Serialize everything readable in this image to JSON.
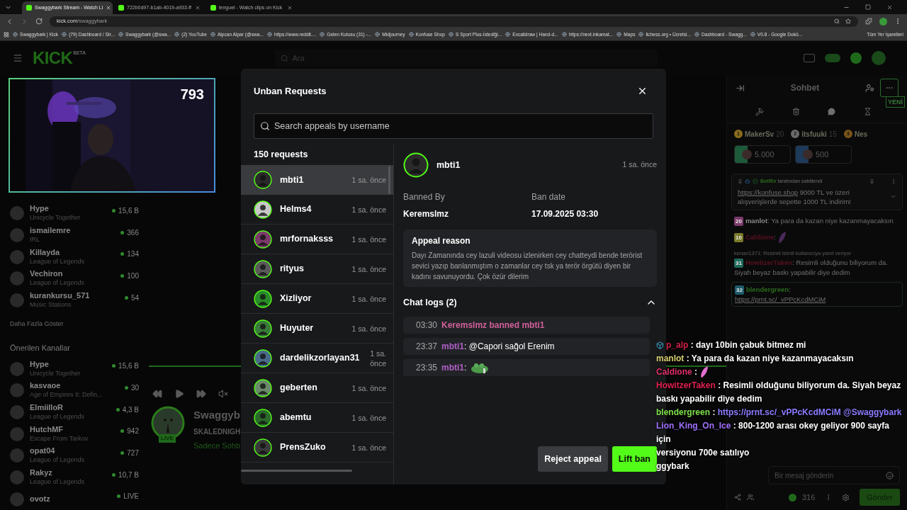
{
  "browser": {
    "tabs": [
      {
        "title": "Swaggybark Stream - Watch Li",
        "selected": true
      },
      {
        "title": "722b0d97-b1ab-4019-a933-ff",
        "selected": false
      },
      {
        "title": "lenguel - Watch clips on Kick",
        "selected": false
      }
    ],
    "url_host": "kick.com",
    "url_path": "/swaggybark",
    "bookmarks": [
      "Swaggybark | Kick",
      "(79) Dashboard / Str...",
      "Swaggybark (@swa...",
      "(2) YouTube",
      "Alpcan Alpar (@swa...",
      "https://www.reddit....",
      "Gelen Kutusu (31) -...",
      "Midjourney",
      "Konfuse Shop",
      "S Sport Plus-İstediği...",
      "Excalidraw | Hand-d...",
      "https://next.inkamat...",
      "Maps",
      "lichess.org • Ücretsi...",
      "Dashboard - Swagg...",
      "V0.8 - Google Dokü..."
    ],
    "all_bookmarks": "Tüm Yer İşaretleri"
  },
  "nav": {
    "logo": "KICK",
    "logo_tag": "BETA",
    "search_placeholder": "Ara"
  },
  "webcam": {
    "viewers": "793"
  },
  "sidebar": {
    "followed": [
      {
        "name": "Hype",
        "category": "Unicycle Together",
        "viewers": "15,6 B"
      },
      {
        "name": "ismailemre",
        "category": "IRL",
        "viewers": "366"
      },
      {
        "name": "Killayda",
        "category": "League of Legends",
        "viewers": "134"
      },
      {
        "name": "Vechiron",
        "category": "League of Legends",
        "viewers": "100"
      },
      {
        "name": "kurankursu_571",
        "category": "Music Stations",
        "viewers": "54"
      }
    ],
    "show_more": "Daha Fazla Göster",
    "suggested_title": "Önerilen Kanallar",
    "suggested": [
      {
        "name": "Hype",
        "category": "Unicycle Together",
        "viewers": "15,6 B"
      },
      {
        "name": "kasvaoe",
        "category": "Age of Empires II: Defin...",
        "viewers": "30"
      },
      {
        "name": "ElmiilloR",
        "category": "League of Legends",
        "viewers": "4,3 B"
      },
      {
        "name": "HutchMF",
        "category": "Escape From Tarkov",
        "viewers": "942"
      },
      {
        "name": "opat04",
        "category": "League of Legends",
        "viewers": "727"
      },
      {
        "name": "Rakyz",
        "category": "League of Legends",
        "viewers": "10,7 B"
      },
      {
        "name": "ovotz",
        "viewers": "LIVE"
      }
    ]
  },
  "player": {
    "channel": "Swaggyb",
    "title": "SKALEDNIGH",
    "tag": "Sadece Sohb",
    "live_badge": "LIVE"
  },
  "chat": {
    "title": "Sohbet",
    "new_badge": "YENİ",
    "leaders": [
      {
        "rank": "1",
        "name": "MakerSv",
        "score": "20",
        "color": "#8a6d1c"
      },
      {
        "rank": "2",
        "name": "itsfuuki",
        "score": "15",
        "color": "#6a6a6a"
      },
      {
        "rank": "3",
        "name": "Nes",
        "color": "#7a5418"
      }
    ],
    "gifts": [
      {
        "amount": "5.000",
        "color": "#1d5a3a"
      },
      {
        "amount": "500",
        "color": "#1d3a5a"
      }
    ],
    "pinned": {
      "by": "BotRix",
      "by_suffix": "tarafından sabitlendi",
      "link": "https://konfuse.shop",
      "text": " 9000 TL ve üzeri alışverişlerde sepette 1000 TL indirim!"
    },
    "messages": [
      {
        "badge": {
          "text": "20",
          "color": "#7a3a6a"
        },
        "user": "manlot",
        "color": "#8a8a8a",
        "text": ": Ya para da kazan niye kazanmayacaksın"
      },
      {
        "badge": {
          "text": "10",
          "color": "#7a7a2a"
        },
        "user": "Caldione",
        "color": "#5a1020",
        "text": ":",
        "kind": "emote"
      },
      {
        "badge": {
          "text": "31",
          "color": "#1d6a5a"
        },
        "user": "HowitzerTaken",
        "color": "#5a1020",
        "text": ": Resimli olduğunu biliyorum da. Siyah beyaz baskı yapabilir diye dedim",
        "reply": "kenan1371: Resimli isimli kullanıcıya yanıt veriyor"
      },
      {
        "badge": {
          "text": "32",
          "color": "#1d5a6a"
        },
        "user": "blendergreen",
        "color": "#2a6a1a",
        "text": ":",
        "link": "https://prnt.sc/_vPPcKcdMCiM",
        "kind": "link"
      }
    ],
    "input_placeholder": "Bir mesaj gönderin",
    "points": "316",
    "send": "Gönder"
  },
  "stream_chat": {
    "messages": [
      {
        "user": "p_alp",
        "color": "#d0204a",
        "text": ": dayı 10bin çabuk bitmez mi",
        "kind": "cube"
      },
      {
        "user": "manlot",
        "color": "#d8d070",
        "text": ": Ya para da kazan niye kazanmayacaksın"
      },
      {
        "user": "Caldione",
        "color": "#e0306a",
        "text": ":",
        "kind": "emote"
      },
      {
        "user": "HowitzerTaken",
        "color": "#e02050",
        "text": ": Resimli olduğunu biliyorum da. Siyah beyaz baskı yapabilir diye dedim"
      },
      {
        "user": "blendergreen",
        "color": "#7ee04a",
        "text": ":",
        "link": "https://prnt.sc/_vPPcKcdMCiM @Swaggybark",
        "kind": "link"
      },
      {
        "user": "Lion_King_On_Ice",
        "color": "#a070ff",
        "text": ": 800-1200 arası okey geliyor 900 sayfa için"
      }
    ],
    "fragments": [
      "versiyonu 700e satılıyo",
      "ggybark"
    ]
  },
  "modal": {
    "title": "Unban Requests",
    "search_placeholder": "Search appeals by username",
    "count": "150 requests",
    "requests": [
      {
        "name": "mbti1",
        "time": "1 sa. önce",
        "selected": true
      },
      {
        "name": "Helms4",
        "time": "1 sa. önce",
        "selected": false
      },
      {
        "name": "mrfornaksss",
        "time": "1 sa. önce",
        "selected": false
      },
      {
        "name": "rityus",
        "time": "1 sa. önce",
        "selected": false
      },
      {
        "name": "Xizliyor",
        "time": "1 sa. önce",
        "selected": false
      },
      {
        "name": "Huyuter",
        "time": "1 sa. önce",
        "selected": false
      },
      {
        "name": "dardelikzorlayan31",
        "time": "1 sa. önce",
        "selected": false
      },
      {
        "name": "geberten",
        "time": "1 sa. önce",
        "selected": false
      },
      {
        "name": "abemtu",
        "time": "1 sa. önce",
        "selected": false
      },
      {
        "name": "PrensZuko",
        "time": "1 sa. önce",
        "selected": false
      }
    ],
    "detail": {
      "name": "mbti1",
      "time": "1 sa. önce",
      "banned_by_label": "Banned By",
      "banned_by": "Keremslmz",
      "ban_date_label": "Ban date",
      "ban_date": "17.09.2025 03:30",
      "reason_title": "Appeal reason",
      "reason": "Dayı Zamanında cey lazuli videosu izlenirken cey chatteydi bende terörist sevici yazıp banlanmıştım o zamanlar cey tsk ya terör örgütü diyen bir kadını savunuyordu. Çok özür dilerim",
      "logs_title": "Chat logs (2)",
      "logs_expanded": true,
      "logs": [
        {
          "kind": "ban",
          "time": "03:30",
          "text": "Keremslmz banned mbti1"
        },
        {
          "kind": "message",
          "time": "23:37",
          "user": "mbti1",
          "text": ": @Capori sağol Erenim"
        },
        {
          "kind": "emote",
          "time": "23:35",
          "user": "mbti1",
          "text": ":"
        }
      ]
    },
    "buttons": {
      "reject": "Reject appeal",
      "lift": "Lift ban"
    }
  }
}
